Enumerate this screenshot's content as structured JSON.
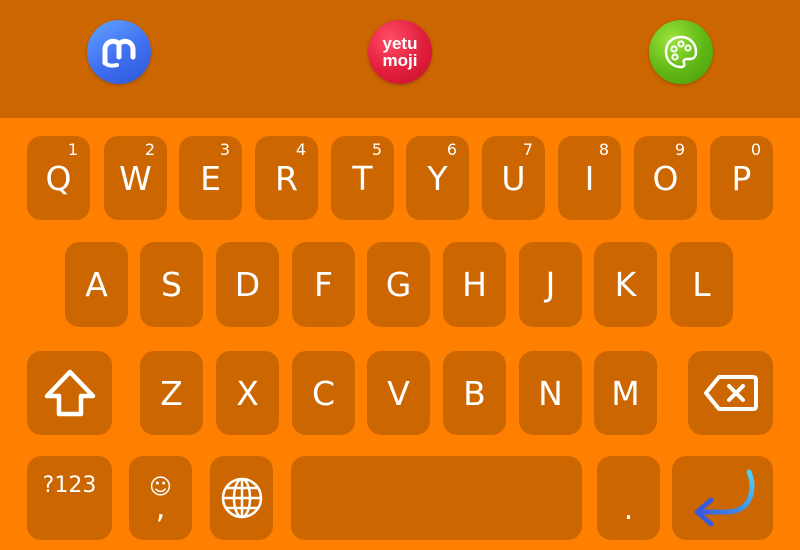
{
  "toolbar": {
    "apps": [
      {
        "name": "mastodon",
        "icon": "mastodon-icon",
        "color": "#3f6ff0"
      },
      {
        "name": "yetumoji",
        "icon": "yetumoji-icon",
        "label_line1": "yetu",
        "label_line2": "moji",
        "color": "#e01e3c"
      },
      {
        "name": "paint",
        "icon": "palette-icon",
        "color": "#5fb714"
      }
    ],
    "background": "#cc6600"
  },
  "keyboard": {
    "background": "#ff7f00",
    "key_color": "#cc6600",
    "row1": [
      {
        "label": "Q",
        "hint": "1"
      },
      {
        "label": "W",
        "hint": "2"
      },
      {
        "label": "E",
        "hint": "3"
      },
      {
        "label": "R",
        "hint": "4"
      },
      {
        "label": "T",
        "hint": "5"
      },
      {
        "label": "Y",
        "hint": "6"
      },
      {
        "label": "U",
        "hint": "7"
      },
      {
        "label": "I",
        "hint": "8"
      },
      {
        "label": "O",
        "hint": "9"
      },
      {
        "label": "P",
        "hint": "0"
      }
    ],
    "row2": [
      "A",
      "S",
      "D",
      "F",
      "G",
      "H",
      "J",
      "K",
      "L"
    ],
    "row3": [
      "Z",
      "X",
      "C",
      "V",
      "B",
      "N",
      "M"
    ],
    "symbols_label": "?123",
    "emoji_smiley": "☺",
    "comma_label": ",",
    "period_label": ".",
    "shift_icon": "shift-icon",
    "backspace_icon": "backspace-icon",
    "globe_icon": "globe-icon",
    "enter_icon": "enter-icon"
  }
}
